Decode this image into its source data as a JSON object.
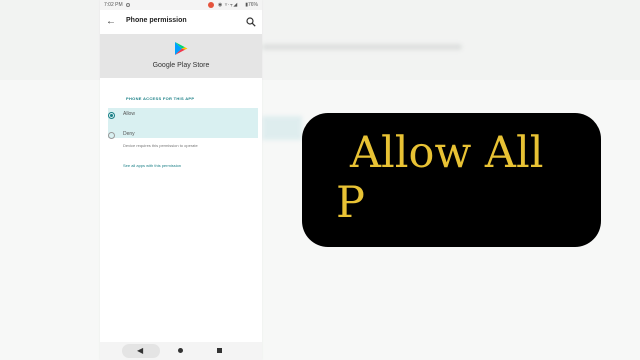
{
  "status_bar": {
    "time": "7:02 PM",
    "icons": "◉ ▿·⨥◢",
    "battery": "▮76%"
  },
  "app_bar": {
    "title": "Phone permission",
    "back_icon": "back-arrow-icon",
    "search_icon": "search-icon"
  },
  "app_header": {
    "app_name": "Google Play Store",
    "logo_icon": "google-play-logo"
  },
  "permission": {
    "section_label": "PHONE ACCESS FOR THIS APP",
    "options": [
      {
        "label": "Allow",
        "selected": true,
        "sub": ""
      },
      {
        "label": "Deny",
        "selected": false,
        "sub": "Device requires this permission to operate"
      }
    ],
    "see_all_link": "See all apps with this permission"
  },
  "nav_bar": {
    "back": "◀"
  },
  "caption": {
    "line1": "Allow All",
    "line2": "P",
    "text_color": "#e8c234",
    "bg_color": "#000000"
  },
  "colors": {
    "accent": "#1a7f86"
  }
}
